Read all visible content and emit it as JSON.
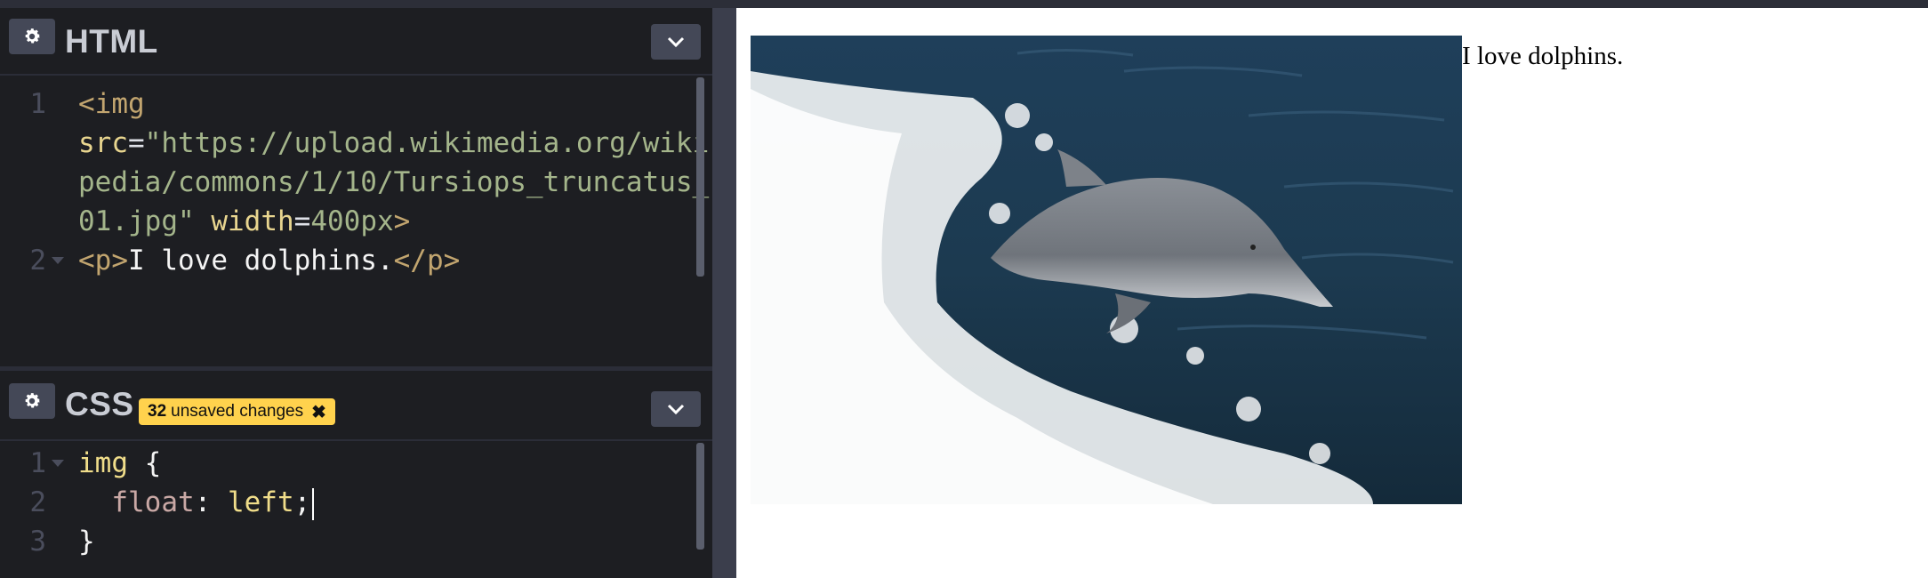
{
  "html_panel": {
    "title": "HTML",
    "gear_icon": "gear-icon",
    "collapse_icon": "chevron-down-icon",
    "lines": [
      {
        "number": "1",
        "segments": [
          {
            "t": "<img",
            "k": "tag"
          }
        ]
      },
      {
        "number": "",
        "segments": [
          {
            "t": "src",
            "k": "attr"
          },
          {
            "t": "=",
            "k": "eq"
          },
          {
            "t": "\"https://upload.wikimedia.org/wiki",
            "k": "str"
          }
        ]
      },
      {
        "number": "",
        "segments": [
          {
            "t": "pedia/commons/1/10/Tursiops_truncatus_",
            "k": "str"
          }
        ]
      },
      {
        "number": "",
        "segments": [
          {
            "t": "01.jpg\"",
            "k": "str"
          },
          {
            "t": " ",
            "k": "text"
          },
          {
            "t": "width",
            "k": "attr"
          },
          {
            "t": "=",
            "k": "eq"
          },
          {
            "t": "400px",
            "k": "str"
          },
          {
            "t": ">",
            "k": "tag"
          }
        ]
      },
      {
        "number": "2",
        "fold": true,
        "segments": [
          {
            "t": "<p>",
            "k": "tag"
          },
          {
            "t": "I love dolphins.",
            "k": "text"
          },
          {
            "t": "</p>",
            "k": "tag"
          }
        ]
      }
    ]
  },
  "css_panel": {
    "title": "CSS",
    "badge_count": "32",
    "badge_text": "unsaved changes",
    "badge_close_glyph": "✖",
    "gear_icon": "gear-icon",
    "collapse_icon": "chevron-down-icon",
    "lines": [
      {
        "number": "1",
        "fold": true,
        "segments": [
          {
            "t": "img",
            "k": "sel"
          },
          {
            "t": " {",
            "k": "punc"
          }
        ]
      },
      {
        "number": "2",
        "cursor": true,
        "segments": [
          {
            "t": "  float",
            "k": "prop"
          },
          {
            "t": ": ",
            "k": "punc"
          },
          {
            "t": "left",
            "k": "sel"
          },
          {
            "t": ";",
            "k": "punc"
          }
        ]
      },
      {
        "number": "3",
        "segments": [
          {
            "t": "}",
            "k": "punc"
          }
        ]
      }
    ]
  },
  "preview": {
    "image_alt": "dolphin-photo",
    "paragraph": "I love dolphins."
  }
}
